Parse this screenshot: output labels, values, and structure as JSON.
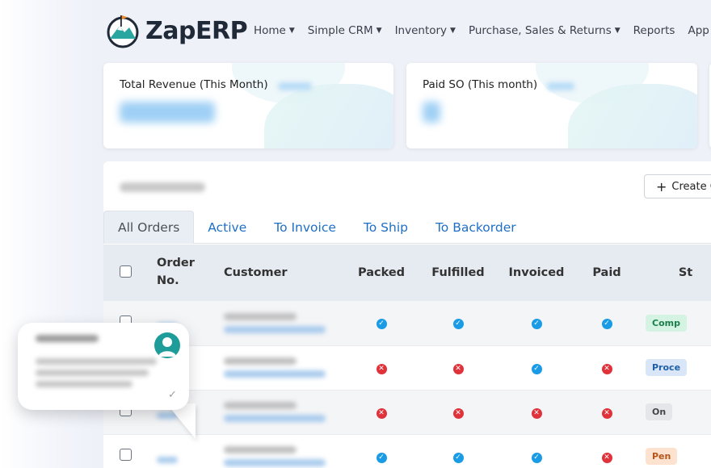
{
  "brand": {
    "name": "ZapERP"
  },
  "nav": [
    {
      "label": "Home",
      "dropdown": true
    },
    {
      "label": "Simple CRM",
      "dropdown": true
    },
    {
      "label": "Inventory",
      "dropdown": true
    },
    {
      "label": "Purchase, Sales & Returns",
      "dropdown": true
    },
    {
      "label": "Reports",
      "dropdown": false
    },
    {
      "label": "App",
      "dropdown": false
    }
  ],
  "kpis": [
    {
      "title": "Total Revenue (This Month)"
    },
    {
      "title": "Paid SO (This month)"
    }
  ],
  "panel": {
    "create_label": "Create O"
  },
  "tabs": [
    {
      "label": "All Orders",
      "active": true
    },
    {
      "label": "Active",
      "active": false
    },
    {
      "label": "To Invoice",
      "active": false
    },
    {
      "label": "To Ship",
      "active": false
    },
    {
      "label": "To Backorder",
      "active": false
    }
  ],
  "table": {
    "headers": [
      "",
      "Order No.",
      "Customer",
      "Packed",
      "Fulfilled",
      "Invoiced",
      "Paid",
      "St"
    ],
    "rows": [
      {
        "packed": true,
        "fulfilled": true,
        "invoiced": true,
        "paid": true,
        "status": "Comp",
        "status_color": "#d5f3e3",
        "status_text_color": "#1a7f4b"
      },
      {
        "packed": false,
        "fulfilled": false,
        "invoiced": true,
        "paid": false,
        "status": "Proce",
        "status_color": "#d9e6f8",
        "status_text_color": "#1f5fa8"
      },
      {
        "packed": false,
        "fulfilled": false,
        "invoiced": false,
        "paid": false,
        "status": "On",
        "status_color": "#e4e6e9",
        "status_text_color": "#444"
      },
      {
        "packed": true,
        "fulfilled": true,
        "invoiced": true,
        "paid": false,
        "status": "Pen",
        "status_color": "#fde3cf",
        "status_text_color": "#b4561b"
      }
    ]
  },
  "colors": {
    "accent": "#1f6fc5",
    "ok": "#1a9be6",
    "error": "#e0323a"
  }
}
